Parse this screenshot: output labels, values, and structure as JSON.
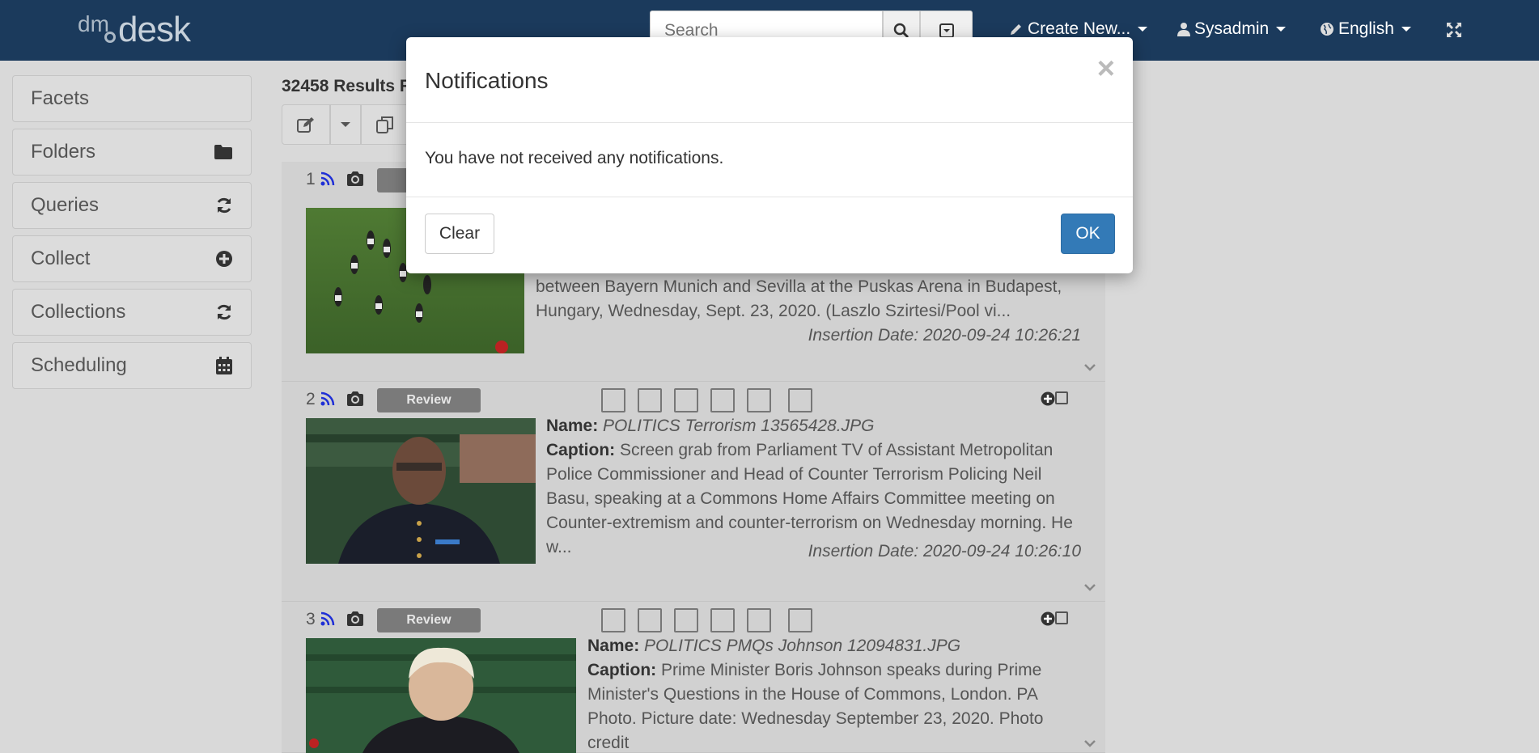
{
  "header": {
    "logo_dm": "dm",
    "logo_desk": "desk",
    "search_placeholder": "Search",
    "create_new": "Create New...",
    "user": "Sysadmin",
    "language": "English"
  },
  "sidebar": {
    "items": [
      {
        "label": "Facets",
        "icon": ""
      },
      {
        "label": "Folders",
        "icon": "folder-icon"
      },
      {
        "label": "Queries",
        "icon": "refresh-icon"
      },
      {
        "label": "Collect",
        "icon": "plus-circle-icon"
      },
      {
        "label": "Collections",
        "icon": "refresh-icon"
      },
      {
        "label": "Scheduling",
        "icon": "calendar-icon"
      }
    ]
  },
  "main": {
    "results_count": "32458 Results F",
    "items": [
      {
        "num": "1",
        "badge": "",
        "caption_tail": "between Bayern Munich and Sevilla at the Puskas Arena in Budapest, Hungary, Wednesday, Sept. 23, 2020. (Laszlo Szirtesi/Pool vi...",
        "insertion_date": "Insertion Date: 2020-09-24 10:26:21"
      },
      {
        "num": "2",
        "badge": "Review",
        "name_label": "Name:",
        "name": "POLITICS Terrorism 13565428.JPG",
        "caption_label": "Caption:",
        "caption": "Screen grab from Parliament TV of Assistant Metropolitan Police Commissioner and Head of Counter Terrorism Policing Neil Basu, speaking at a Commons Home Affairs Committee meeting on Counter-extremism and counter-terrorism on Wednesday morning. He w...",
        "insertion_date": "Insertion Date: 2020-09-24 10:26:10"
      },
      {
        "num": "3",
        "badge": "Review",
        "name_label": "Name:",
        "name": "POLITICS PMQs Johnson 12094831.JPG",
        "caption_label": "Caption:",
        "caption": "Prime Minister Boris Johnson speaks during Prime Minister's Questions in the House of Commons, London. PA Photo. Picture date: Wednesday September 23, 2020. Photo credit"
      }
    ]
  },
  "modal": {
    "title": "Notifications",
    "close": "×",
    "message": "You have not received any notifications.",
    "clear_label": "Clear",
    "ok_label": "OK"
  },
  "colors": {
    "topbar": "#1b3a5c",
    "primary_button": "#337ab7",
    "badge": "#7a7a7a",
    "rss": "#1f2fd6"
  }
}
